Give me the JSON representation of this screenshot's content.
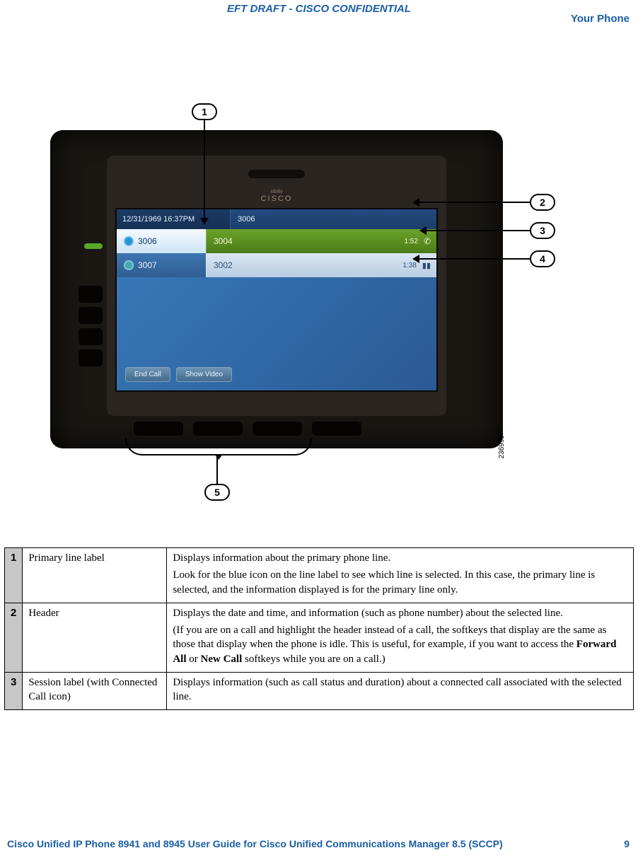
{
  "header": {
    "eft_text": "EFT DRAFT - CISCO CONFIDENTIAL",
    "section_title": "Your Phone"
  },
  "figure": {
    "image_ref": "236999",
    "callouts": {
      "c1": "1",
      "c2": "2",
      "c3": "3",
      "c4": "4",
      "c5": "5"
    },
    "phone": {
      "logo": "CISCO",
      "datetime": "12/31/1969 16:37PM",
      "header_number": "3006",
      "lines": [
        {
          "label": "3006",
          "session": "3004",
          "duration": "1:52"
        },
        {
          "label": "3007",
          "session": "3002",
          "duration": "1:38"
        }
      ],
      "softkeys": {
        "end_call": "End Call",
        "show_video": "Show Video"
      }
    }
  },
  "table": {
    "rows": [
      {
        "num": "1",
        "name": "Primary line label",
        "desc_p1": "Displays information about the primary phone line.",
        "desc_p2": "Look for the blue icon on the line label to see which line is selected. In this case, the primary line is selected, and the information displayed is for the primary line only."
      },
      {
        "num": "2",
        "name": "Header",
        "desc_p1": "Displays the date and time, and information (such as phone number) about the selected line.",
        "desc_p2_pre": "(If you are on a call and highlight the header instead of a call, the softkeys that display are the same as those that display when the phone is idle. This is useful, for example, if you want to access the ",
        "desc_p2_b1": "Forward All",
        "desc_p2_mid": " or ",
        "desc_p2_b2": "New Call",
        "desc_p2_post": " softkeys while you are on a call.)"
      },
      {
        "num": "3",
        "name": "Session label (with Connected Call icon)",
        "desc_p1": "Displays information (such as call status and duration) about a connected call associated with the selected line."
      }
    ]
  },
  "footer": {
    "book_title": "Cisco Unified IP Phone 8941 and 8945 User Guide for Cisco Unified Communications Manager 8.5 (SCCP)",
    "page_num": "9"
  }
}
